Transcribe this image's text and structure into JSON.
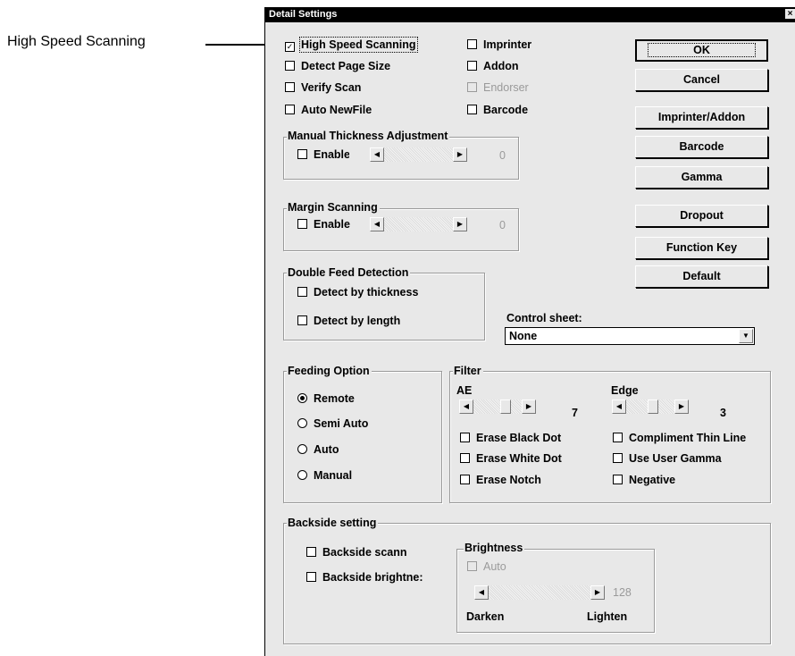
{
  "callout": {
    "label": "High Speed Scanning"
  },
  "dialog": {
    "title": "Detail Settings",
    "close_glyph": "×"
  },
  "checks": {
    "high_speed": {
      "label": "High Speed Scanning",
      "checked": true
    },
    "detect_page_size": {
      "label": "Detect Page Size",
      "checked": false
    },
    "verify_scan": {
      "label": "Verify Scan",
      "checked": false
    },
    "auto_newfile": {
      "label": "Auto NewFile",
      "checked": false
    },
    "imprinter": {
      "label": "Imprinter",
      "checked": false
    },
    "addon": {
      "label": "Addon",
      "checked": false
    },
    "endorser": {
      "label": "Endorser",
      "checked": false
    },
    "barcode": {
      "label": "Barcode",
      "checked": false
    }
  },
  "buttons": {
    "ok": "OK",
    "cancel": "Cancel",
    "imprinter_addon": "Imprinter/Addon",
    "barcode": "Barcode",
    "gamma": "Gamma",
    "dropout": "Dropout",
    "function_key": "Function Key",
    "default": "Default"
  },
  "manual_thickness": {
    "legend": "Manual Thickness Adjustment",
    "enable_label": "Enable",
    "value": "0"
  },
  "margin_scanning": {
    "legend": "Margin Scanning",
    "enable_label": "Enable",
    "value": "0"
  },
  "double_feed": {
    "legend": "Double Feed Detection",
    "by_thickness": "Detect by thickness",
    "by_length": "Detect by length"
  },
  "control_sheet": {
    "label": "Control sheet:",
    "value": "None"
  },
  "feeding": {
    "legend": "Feeding Option",
    "options": [
      "Remote",
      "Semi Auto",
      "Auto",
      "Manual"
    ],
    "selected": "Remote"
  },
  "filter": {
    "legend": "Filter",
    "ae": {
      "label": "AE",
      "value": "7"
    },
    "edge": {
      "label": "Edge",
      "value": "3"
    },
    "erase_black_dot": "Erase Black Dot",
    "erase_white_dot": "Erase White Dot",
    "erase_notch": "Erase Notch",
    "compliment_thin_line": "Compliment Thin Line",
    "use_user_gamma": "Use User Gamma",
    "negative": "Negative"
  },
  "backside": {
    "legend": "Backside setting",
    "scan_label": "Backside scann",
    "brightness_label": "Backside brightne:",
    "brightness_group": {
      "legend": "Brightness",
      "auto_label": "Auto",
      "value": "128",
      "darken": "Darken",
      "lighten": "Lighten"
    }
  }
}
